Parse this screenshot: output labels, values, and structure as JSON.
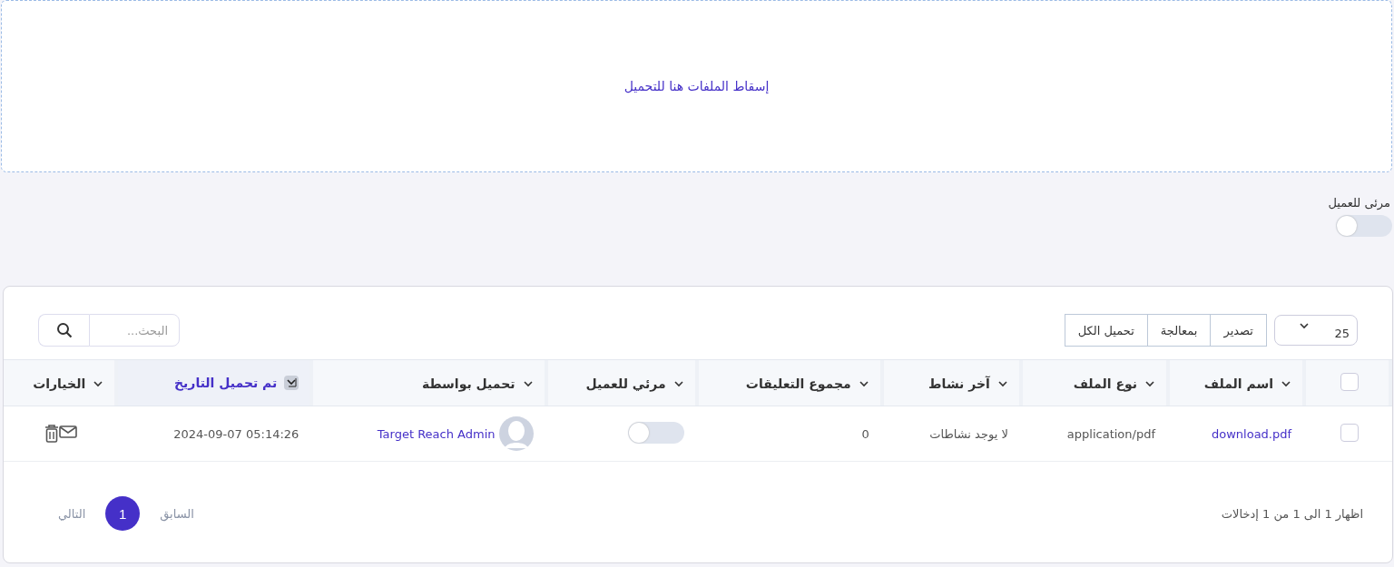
{
  "dropzone": {
    "text": "إسقاط الملفات هنا للتحميل"
  },
  "visibility": {
    "label": "مرئى للعميل",
    "on": false
  },
  "toolbar": {
    "page_size": "25",
    "buttons": [
      "تصدير",
      "بمعالجة",
      "تحميل الكل"
    ],
    "search": {
      "placeholder": "البحث..."
    }
  },
  "table": {
    "select_all": {
      "checked": false
    },
    "columns": [
      {
        "label": "اسم الملف",
        "sorted": false
      },
      {
        "label": "نوع الملف",
        "sorted": false
      },
      {
        "label": "آخر نشاط",
        "sorted": false
      },
      {
        "label": "مجموع التعليقات",
        "sorted": false
      },
      {
        "label": "مرئي للعميل",
        "sorted": false
      },
      {
        "label": "تحميل بواسطة",
        "sorted": false
      },
      {
        "label": "تم تحميل التاريخ",
        "sorted": true
      },
      {
        "label": "الخيارات",
        "sorted": false
      }
    ],
    "rows": [
      {
        "checked": false,
        "file_name": "download.pdf",
        "file_type": "application/pdf",
        "last_activity": "لا يوجد نشاطات",
        "comments": "0",
        "visible": false,
        "uploaded_by": "Target Reach Admin",
        "uploaded_at": "05:14:26 2024-09-07"
      }
    ]
  },
  "footer": {
    "info": "اظهار 1 الى 1 من 1 إدخالات",
    "pages": [
      {
        "kind": "prev",
        "label": "السابق",
        "selected": false
      },
      {
        "kind": "page",
        "label": "1",
        "selected": true
      },
      {
        "kind": "next",
        "label": "التالي",
        "selected": false
      }
    ]
  }
}
